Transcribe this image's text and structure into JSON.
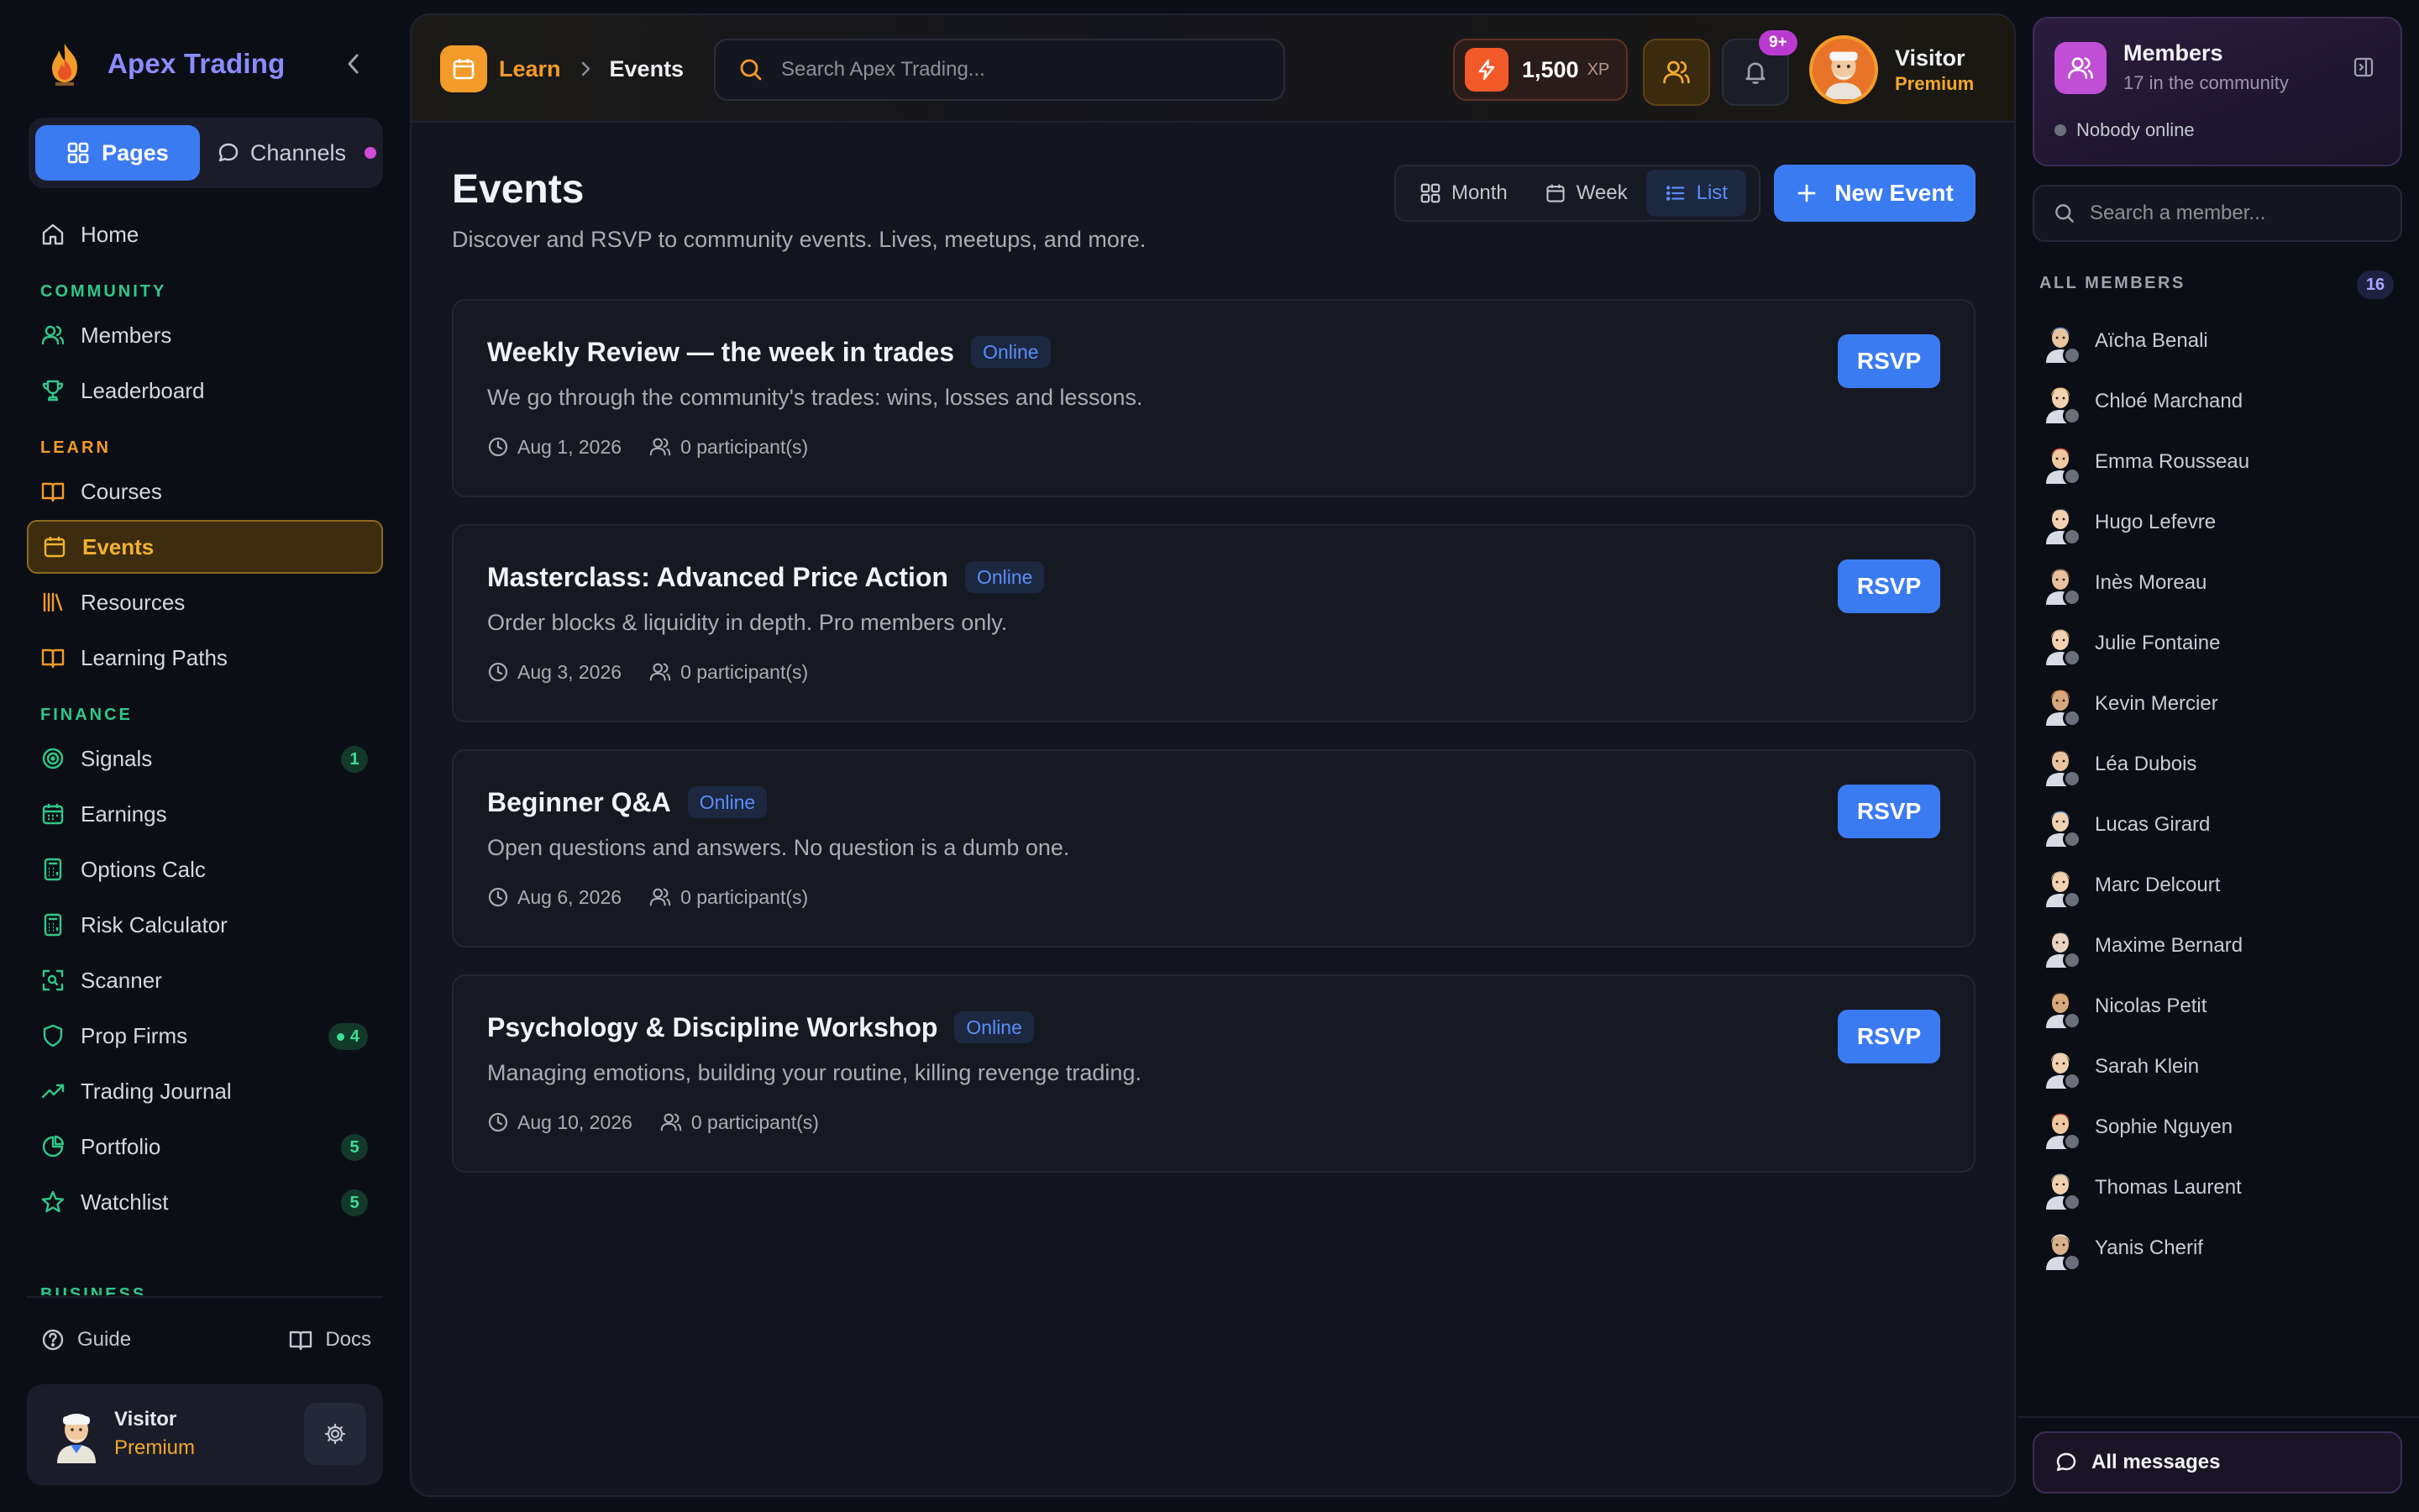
{
  "brand": {
    "name": "Apex Trading"
  },
  "sidebar": {
    "switcher": {
      "pages": "Pages",
      "channels": "Channels"
    },
    "home": "Home",
    "sections": {
      "community": "COMMUNITY",
      "learn": "LEARN",
      "finance": "FINANCE",
      "business": "BUSINESS"
    },
    "community_items": [
      "Members",
      "Leaderboard"
    ],
    "learn_items": [
      "Courses",
      "Events",
      "Resources",
      "Learning Paths"
    ],
    "finance_items": [
      {
        "label": "Signals",
        "badge": "1"
      },
      {
        "label": "Earnings",
        "badge": ""
      },
      {
        "label": "Options Calc",
        "badge": ""
      },
      {
        "label": "Risk Calculator",
        "badge": ""
      },
      {
        "label": "Scanner",
        "badge": ""
      },
      {
        "label": "Prop Firms",
        "badge": "4"
      },
      {
        "label": "Trading Journal",
        "badge": ""
      },
      {
        "label": "Portfolio",
        "badge": "5"
      },
      {
        "label": "Watchlist",
        "badge": "5"
      }
    ],
    "footer": {
      "guide": "Guide",
      "docs": "Docs"
    },
    "user": {
      "name": "Visitor",
      "role": "Premium"
    }
  },
  "topbar": {
    "breadcrumb": {
      "parent": "Learn",
      "current": "Events"
    },
    "search_placeholder": "Search Apex Trading...",
    "xp_value": "1,500",
    "xp_label": "XP",
    "notifications": "9+",
    "user": {
      "name": "Visitor",
      "role": "Premium"
    }
  },
  "page": {
    "title": "Events",
    "subtitle": "Discover and RSVP to community events. Lives, meetups, and more.",
    "views": [
      "Month",
      "Week",
      "List"
    ],
    "active_view": "List",
    "new_event": "New Event",
    "rsvp_label": "RSVP"
  },
  "events": [
    {
      "title": "Weekly Review — the week in trades",
      "tag": "Online",
      "desc": "We go through the community's trades: wins, losses and lessons.",
      "date": "Aug 1, 2026",
      "participants": "0 participant(s)"
    },
    {
      "title": "Masterclass: Advanced Price Action",
      "tag": "Online",
      "desc": "Order blocks & liquidity in depth. Pro members only.",
      "date": "Aug 3, 2026",
      "participants": "0 participant(s)"
    },
    {
      "title": "Beginner Q&A",
      "tag": "Online",
      "desc": "Open questions and answers. No question is a dumb one.",
      "date": "Aug 6, 2026",
      "participants": "0 participant(s)"
    },
    {
      "title": "Psychology & Discipline Workshop",
      "tag": "Online",
      "desc": "Managing emotions, building your routine, killing revenge trading.",
      "date": "Aug 10, 2026",
      "participants": "0 participant(s)"
    }
  ],
  "members_panel": {
    "title": "Members",
    "subtitle": "17 in the community",
    "online": "Nobody online",
    "search_placeholder": "Search a member...",
    "all_heading": "ALL MEMBERS",
    "count": "16",
    "members": [
      "Aïcha Benali",
      "Chloé Marchand",
      "Emma Rousseau",
      "Hugo Lefevre",
      "Inès Moreau",
      "Julie Fontaine",
      "Kevin Mercier",
      "Léa Dubois",
      "Lucas Girard",
      "Marc Delcourt",
      "Maxime Bernard",
      "Nicolas Petit",
      "Sarah Klein",
      "Sophie Nguyen",
      "Thomas Laurent",
      "Yanis Cherif"
    ],
    "all_messages": "All messages"
  },
  "colors": {
    "accent_blue": "#3b7bf2",
    "accent_orange": "#f29b2a",
    "accent_green": "#2fc889",
    "accent_purple": "#c04fd6"
  }
}
